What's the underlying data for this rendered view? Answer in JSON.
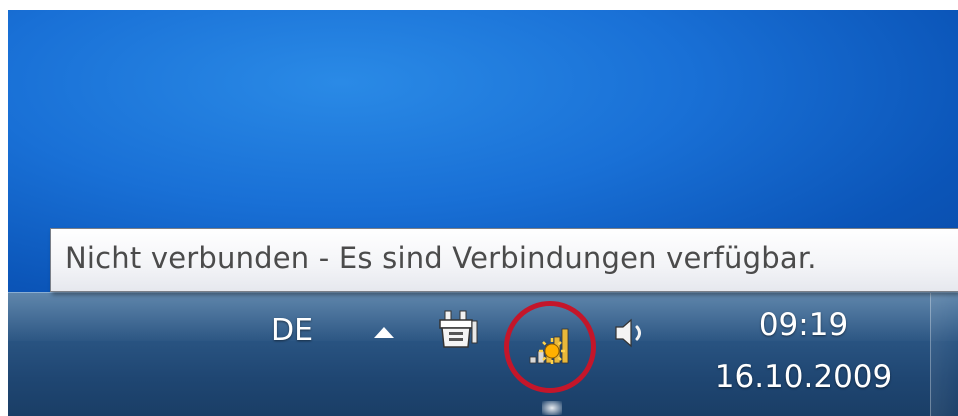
{
  "tooltip": {
    "text": "Nicht verbunden - Es sind Verbindungen verfügbar."
  },
  "tray": {
    "language": "DE",
    "icons": [
      "show-hidden-icons-chevron",
      "power-plug-icon",
      "network-signal-icon",
      "speaker-icon"
    ]
  },
  "clock": {
    "time": "09:19",
    "date": "16.10.2009"
  },
  "colors": {
    "desktop": "#1970d6",
    "taskbar": "#2a5583",
    "highlight_ring": "#c4162a",
    "tooltip_text": "#4b4b4b"
  }
}
